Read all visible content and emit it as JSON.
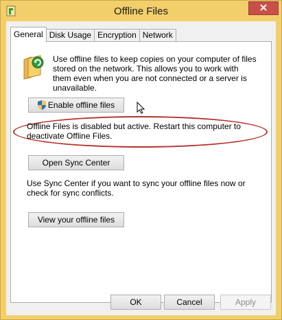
{
  "window": {
    "title": "Offline Files",
    "close_icon": "close-icon",
    "app_icon": "offline-files-app-icon"
  },
  "tabs": [
    {
      "label": "General",
      "active": true
    },
    {
      "label": "Disk Usage",
      "active": false
    },
    {
      "label": "Encryption",
      "active": false
    },
    {
      "label": "Network",
      "active": false
    }
  ],
  "general": {
    "description": "Use offline files to keep copies on your computer of files stored on the network.  This allows you to work with them even when you are not connected or a server is unavailable.",
    "enable_button": "Enable offline files",
    "status": "Offline Files is disabled but active.  Restart this computer to deactivate Offline Files.",
    "sync_button": "Open Sync Center",
    "sync_description": "Use Sync Center if you want to sync your offline files now or check for sync conflicts.",
    "view_button": "View your offline files"
  },
  "footer": {
    "ok": "OK",
    "cancel": "Cancel",
    "apply": "Apply"
  },
  "colors": {
    "frame": "#f2cf6b",
    "close_button": "#c7504a",
    "highlight_ellipse": "#b5312c"
  }
}
